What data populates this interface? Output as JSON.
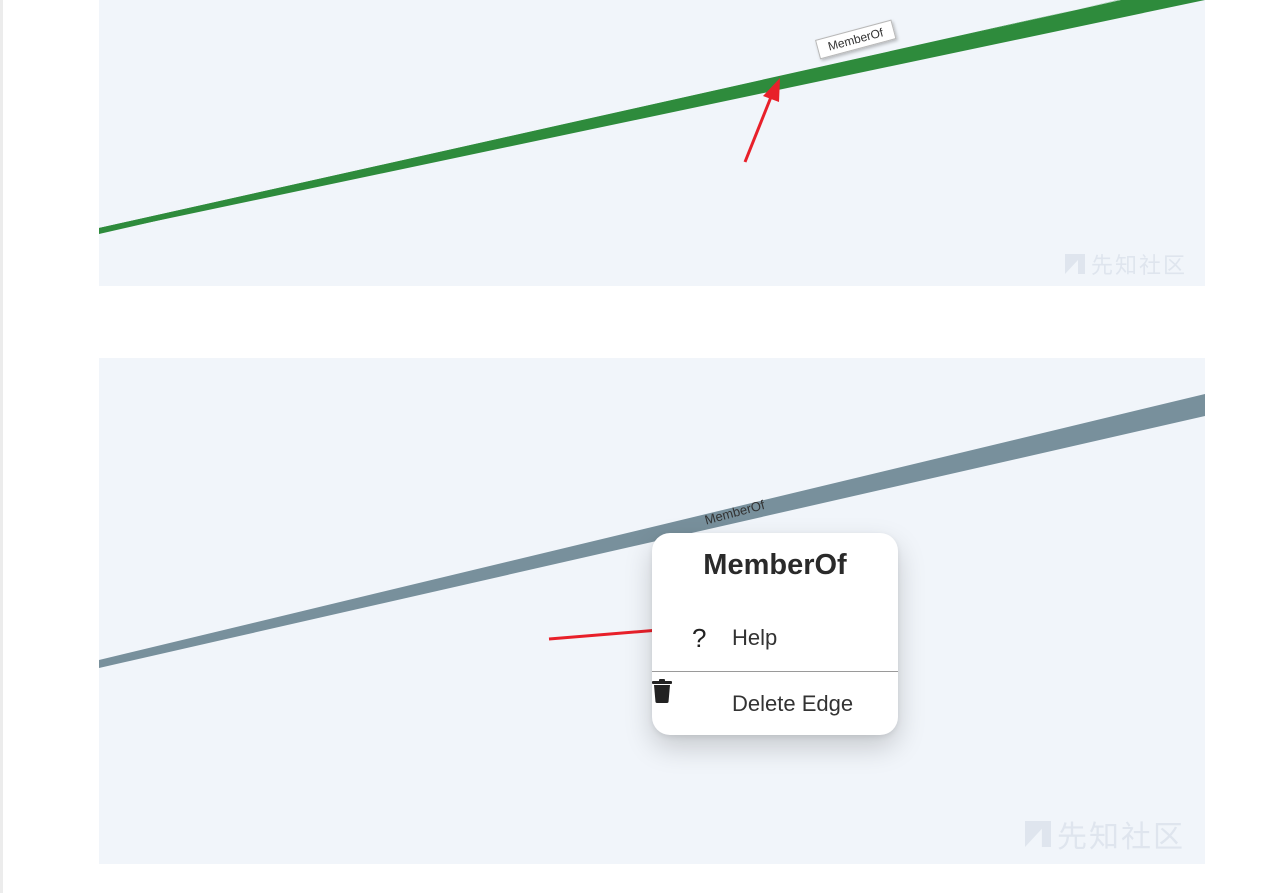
{
  "top_panel": {
    "edge_label": "MemberOf",
    "edge_color": "#2e8b3c",
    "watermark": "先知社区"
  },
  "bottom_panel": {
    "edge_label": "MemberOf",
    "edge_color": "#78909c",
    "watermark": "先知社区",
    "context_menu": {
      "title": "MemberOf",
      "items": [
        {
          "label": "Help",
          "icon": "question-mark-icon"
        },
        {
          "label": "Delete Edge",
          "icon": "trash-icon"
        }
      ]
    }
  },
  "annotation_color": "#e8202a"
}
